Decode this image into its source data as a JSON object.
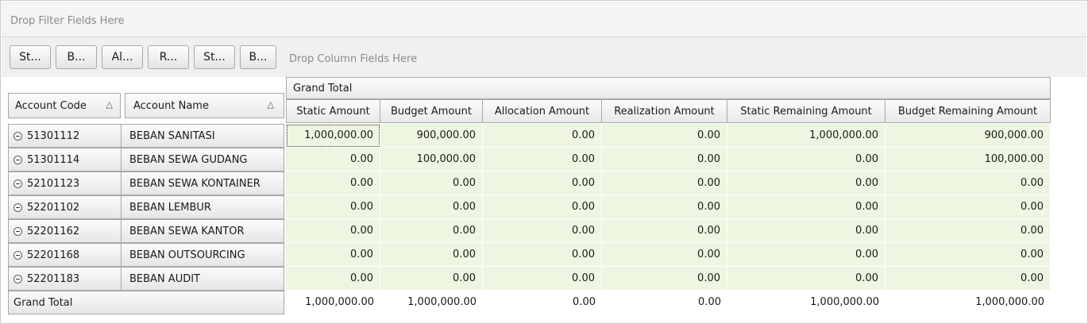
{
  "filter_area": {
    "text": "Drop Filter Fields Here"
  },
  "field_buttons": [
    "St...",
    "B...",
    "Al...",
    "R...",
    "St...",
    "B..."
  ],
  "column_area": {
    "text": "Drop Column Fields Here"
  },
  "grand_total_header": "Grand Total",
  "row_headers": {
    "account_code": "Account Code",
    "account_name": "Account Name",
    "sort_glyph": "△"
  },
  "value_headers": [
    "Static Amount",
    "Budget Amount",
    "Allocation Amount",
    "Realization Amount",
    "Static Remaining Amount",
    "Budget Remaining Amount"
  ],
  "rows": [
    {
      "code": "51301112",
      "name": "BEBAN SANITASI",
      "values": [
        "1,000,000.00",
        "900,000.00",
        "0.00",
        "0.00",
        "1,000,000.00",
        "900,000.00"
      ]
    },
    {
      "code": "51301114",
      "name": "BEBAN SEWA GUDANG",
      "values": [
        "0.00",
        "100,000.00",
        "0.00",
        "0.00",
        "0.00",
        "100,000.00"
      ]
    },
    {
      "code": "52101123",
      "name": "BEBAN SEWA KONTAINER",
      "values": [
        "0.00",
        "0.00",
        "0.00",
        "0.00",
        "0.00",
        "0.00"
      ]
    },
    {
      "code": "52201102",
      "name": "BEBAN LEMBUR",
      "values": [
        "0.00",
        "0.00",
        "0.00",
        "0.00",
        "0.00",
        "0.00"
      ]
    },
    {
      "code": "52201162",
      "name": "BEBAN SEWA KANTOR",
      "values": [
        "0.00",
        "0.00",
        "0.00",
        "0.00",
        "0.00",
        "0.00"
      ]
    },
    {
      "code": "52201168",
      "name": "BEBAN OUTSOURCING",
      "values": [
        "0.00",
        "0.00",
        "0.00",
        "0.00",
        "0.00",
        "0.00"
      ]
    },
    {
      "code": "52201183",
      "name": "BEBAN AUDIT",
      "values": [
        "0.00",
        "0.00",
        "0.00",
        "0.00",
        "0.00",
        "0.00"
      ]
    }
  ],
  "grand_total_row": {
    "label": "Grand Total",
    "values": [
      "1,000,000.00",
      "1,000,000.00",
      "0.00",
      "0.00",
      "1,000,000.00",
      "1,000,000.00"
    ]
  },
  "colors": {
    "cell_bg": "#edf6e0",
    "header_border": "#a8a8a8",
    "hint_text": "#8a8a8a"
  }
}
